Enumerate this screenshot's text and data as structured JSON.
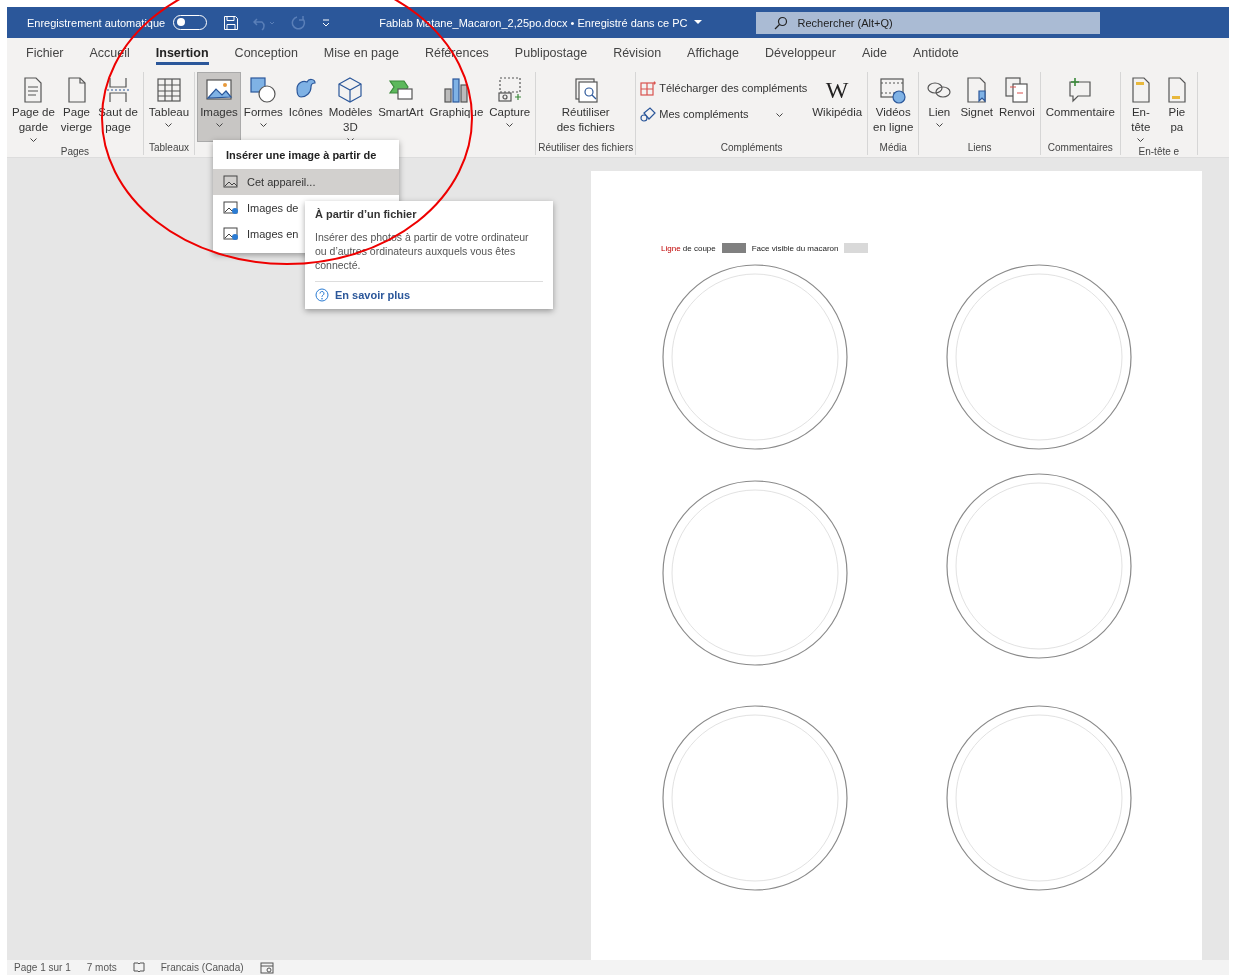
{
  "title_bar": {
    "autosave_label": "Enregistrement automatique",
    "autosave_on": false,
    "document_title": "Fablab Matane_Macaron_2,25po.docx • Enregistré dans ce PC",
    "search": {
      "placeholder": "Rechercher (Alt+Q)"
    }
  },
  "tabs": [
    {
      "label": "Fichier",
      "selected": false
    },
    {
      "label": "Accueil",
      "selected": false
    },
    {
      "label": "Insertion",
      "selected": true
    },
    {
      "label": "Conception",
      "selected": false
    },
    {
      "label": "Mise en page",
      "selected": false
    },
    {
      "label": "Références",
      "selected": false
    },
    {
      "label": "Publipostage",
      "selected": false
    },
    {
      "label": "Révision",
      "selected": false
    },
    {
      "label": "Affichage",
      "selected": false
    },
    {
      "label": "Développeur",
      "selected": false
    },
    {
      "label": "Aide",
      "selected": false
    },
    {
      "label": "Antidote",
      "selected": false
    }
  ],
  "ribbon_groups": [
    {
      "label": "Pages",
      "buttons": [
        {
          "kind": "large",
          "lines": [
            "Page de",
            "garde"
          ],
          "dropdown": true,
          "selected": false
        },
        {
          "kind": "large",
          "lines": [
            "Page",
            "vierge"
          ],
          "dropdown": false,
          "selected": false
        },
        {
          "kind": "large",
          "lines": [
            "Saut de",
            "page"
          ],
          "dropdown": false,
          "selected": false
        }
      ]
    },
    {
      "label": "Tableaux",
      "buttons": [
        {
          "kind": "large",
          "lines": [
            "Tableau"
          ],
          "dropdown": true,
          "selected": false
        }
      ]
    },
    {
      "buttons": [
        {
          "kind": "large",
          "lines": [
            "Images"
          ],
          "dropdown": true,
          "selected": true
        },
        {
          "kind": "large",
          "lines": [
            "Formes"
          ],
          "dropdown": true,
          "selected": false
        },
        {
          "kind": "large",
          "lines": [
            "Icônes"
          ],
          "dropdown": false,
          "selected": false
        },
        {
          "kind": "large",
          "lines": [
            "Modèles",
            "3D"
          ],
          "dropdown": true,
          "selected": false
        },
        {
          "kind": "large",
          "lines": [
            "SmartArt"
          ],
          "dropdown": false,
          "selected": false
        },
        {
          "kind": "large",
          "lines": [
            "Graphique"
          ],
          "dropdown": false,
          "selected": false
        },
        {
          "kind": "large",
          "lines": [
            "Capture"
          ],
          "dropdown": true,
          "selected": false
        }
      ]
    },
    {
      "label": "Réutiliser des fichiers",
      "buttons": [
        {
          "kind": "large",
          "lines": [
            "Réutiliser",
            "des fichiers"
          ],
          "dropdown": false,
          "selected": false
        }
      ]
    },
    {
      "label": "Compléments",
      "buttons": [
        {
          "kind": "small",
          "lines": [
            "Télécharger des compléments"
          ],
          "dropdown": false,
          "selected": false
        },
        {
          "kind": "small",
          "lines": [
            "Mes compléments"
          ],
          "dropdown": true,
          "selected": false
        },
        {
          "kind": "large",
          "lines": [
            "Wikipédia"
          ],
          "glyph": "W",
          "dropdown": false,
          "selected": false
        }
      ]
    },
    {
      "label": "Média",
      "buttons": [
        {
          "kind": "large",
          "lines": [
            "Vidéos",
            "en ligne"
          ],
          "dropdown": false,
          "selected": false
        }
      ]
    },
    {
      "label": "Liens",
      "buttons": [
        {
          "kind": "large",
          "lines": [
            "Lien"
          ],
          "dropdown": true,
          "selected": false
        },
        {
          "kind": "large",
          "lines": [
            "Signet"
          ],
          "dropdown": false,
          "selected": false
        },
        {
          "kind": "large",
          "lines": [
            "Renvoi"
          ],
          "dropdown": false,
          "selected": false
        }
      ]
    },
    {
      "label": "Commentaires",
      "buttons": [
        {
          "kind": "large",
          "lines": [
            "Commentaire"
          ],
          "dropdown": false,
          "selected": false
        }
      ]
    },
    {
      "label": "En-tête e",
      "buttons": [
        {
          "kind": "large",
          "lines": [
            "En-",
            "tête"
          ],
          "dropdown": true,
          "selected": false
        },
        {
          "kind": "large",
          "lines": [
            "Pie",
            "pa"
          ],
          "dropdown": false,
          "selected": false
        }
      ]
    }
  ],
  "images_menu": {
    "header": "Insérer une image à partir de",
    "items": [
      {
        "label": "Cet appareil...",
        "selected": true
      },
      {
        "label": "Images de",
        "selected": false
      },
      {
        "label": "Images en",
        "selected": false
      }
    ]
  },
  "tooltip": {
    "title": "À partir d’un fichier",
    "body": "Insérer des photos à partir de votre ordinateur ou d’autres ordinateurs auxquels vous êtes connecté.",
    "link": "En savoir plus"
  },
  "document": {
    "legend": {
      "cut_word": "Ligne",
      "cut_rest": "de coupe",
      "face_label": "Face visible du macaron"
    }
  },
  "status_bar": {
    "page": "Page 1 sur 1",
    "words": "7 mots",
    "language": "Francais (Canada)"
  }
}
